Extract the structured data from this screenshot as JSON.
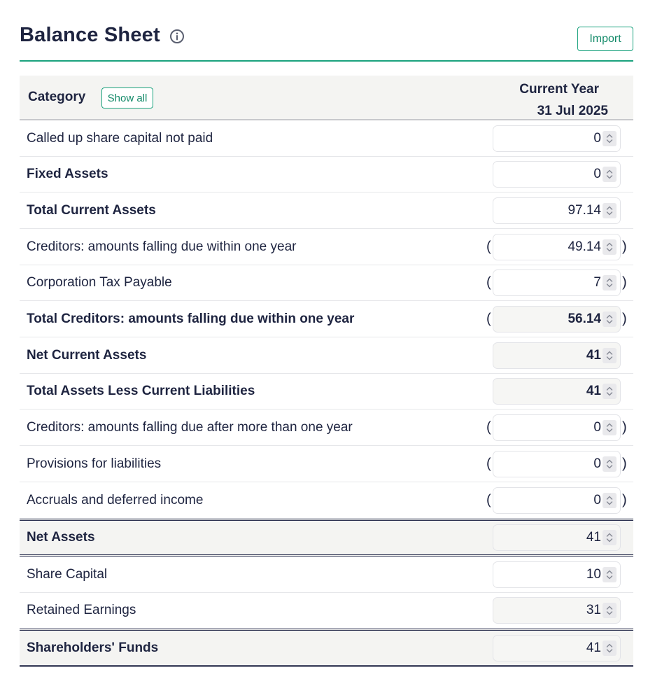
{
  "header": {
    "title": "Balance Sheet",
    "import_label": "Import"
  },
  "table": {
    "category_header": "Category",
    "show_all_label": "Show all",
    "year_header": "Current Year",
    "date_header": "31 Jul 2025"
  },
  "rows": [
    {
      "label": "Called up share capital not paid",
      "value": "0",
      "bold": false,
      "negative": false,
      "readonly": false
    },
    {
      "label": "Fixed Assets",
      "value": "0",
      "bold": true,
      "negative": false,
      "readonly": false
    },
    {
      "label": "Total Current Assets",
      "value": "97.14",
      "bold": true,
      "negative": false,
      "readonly": false
    },
    {
      "label": "Creditors: amounts falling due within one year",
      "value": "49.14",
      "bold": false,
      "negative": true,
      "readonly": false
    },
    {
      "label": "Corporation Tax Payable",
      "value": "7",
      "bold": false,
      "negative": true,
      "readonly": false
    },
    {
      "label": "Total Creditors: amounts falling due within one year",
      "value": "56.14",
      "bold": true,
      "negative": true,
      "readonly": true
    },
    {
      "label": "Net Current Assets",
      "value": "41",
      "bold": true,
      "negative": false,
      "readonly": true
    },
    {
      "label": "Total Assets Less Current Liabilities",
      "value": "41",
      "bold": true,
      "negative": false,
      "readonly": true
    },
    {
      "label": "Creditors: amounts falling due after more than one year",
      "value": "0",
      "bold": false,
      "negative": true,
      "readonly": false
    },
    {
      "label": "Provisions for liabilities",
      "value": "0",
      "bold": false,
      "negative": true,
      "readonly": false
    },
    {
      "label": "Accruals and deferred income",
      "value": "0",
      "bold": false,
      "negative": true,
      "readonly": false
    },
    {
      "label": "Net Assets",
      "value": "41",
      "bold": true,
      "negative": false,
      "readonly": true
    },
    {
      "label": "Share Capital",
      "value": "10",
      "bold": false,
      "negative": false,
      "readonly": false
    },
    {
      "label": "Retained Earnings",
      "value": "31",
      "bold": false,
      "negative": false,
      "readonly": true
    },
    {
      "label": "Shareholders' Funds",
      "value": "41",
      "bold": true,
      "negative": false,
      "readonly": true
    }
  ],
  "colors": {
    "accent": "#1aa27d",
    "text": "#1e2440",
    "header_bg": "#f4f4f2"
  },
  "icons": {
    "info": "info-circle-icon",
    "spinner": "up-down-chevron-icon"
  }
}
